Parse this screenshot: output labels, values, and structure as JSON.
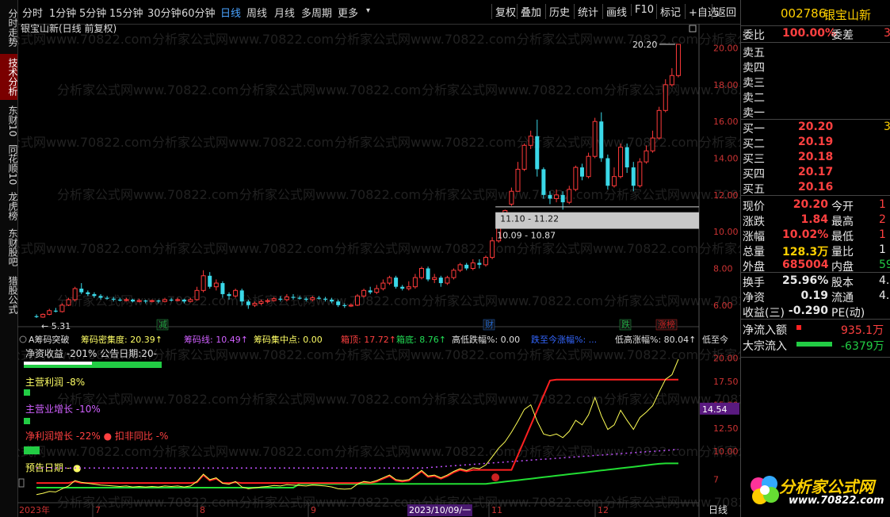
{
  "left_tabs": [
    {
      "label": "分时走势",
      "active": false
    },
    {
      "label": "技术分析",
      "active": true
    },
    {
      "label": "东财10",
      "active": false
    },
    {
      "label": "同花顺10",
      "active": false
    },
    {
      "label": "龙虎榜",
      "active": false
    },
    {
      "label": "东财股吧",
      "active": false
    },
    {
      "label": "猎股公式",
      "active": false
    }
  ],
  "toolbar": {
    "periods": [
      "分时",
      "1分钟",
      "5分钟",
      "15分钟",
      "30分钟",
      "60分钟",
      "日线",
      "周线",
      "月线",
      "多周期",
      "更多"
    ],
    "active_period": "日线",
    "more_arrow": "▾",
    "actions": [
      "复权",
      "叠加",
      "历史",
      "统计",
      "画线",
      "F10",
      "标记",
      "+自选",
      "返回"
    ]
  },
  "main_chart": {
    "title": "银宝山新(日线 前复权)",
    "y_ticks": [
      "20.00",
      "18.00",
      "16.00",
      "14.00",
      "12.00",
      "10.00",
      "8.00",
      "6.00"
    ],
    "max_label": "20.20",
    "min_label": "5.31",
    "range_high_label": "11.10 - 11.22",
    "range_low_label": "10.09 - 10.87"
  },
  "event_flags": [
    {
      "label": "减",
      "color": "#22aa44"
    },
    {
      "label": "财",
      "color": "#2266cc"
    },
    {
      "label": "跌",
      "color": "#22aa44"
    },
    {
      "label": "涨榜",
      "color": "#cc2222"
    }
  ],
  "indicator_header": [
    {
      "text": "A筹码突破",
      "color": "#e0e0e0"
    },
    {
      "text": "筹码密集度: 20.39↑",
      "color": "#ffff66"
    },
    {
      "text": "筹码线: 10.49↑",
      "color": "#d060ff"
    },
    {
      "text": "筹码集中点: 0.00",
      "color": "#ffff66"
    },
    {
      "text": "箱顶: 17.72↑",
      "color": "#ff4040"
    },
    {
      "text": "箱底: 8.76↑",
      "color": "#22dd55"
    },
    {
      "text": "高低跌幅%: 0.00",
      "color": "#e0e0e0"
    },
    {
      "text": "跌至今涨幅%: ...",
      "color": "#3366ff"
    },
    {
      "text": "低高涨幅%: 80.04↑",
      "color": "#e0e0e0"
    },
    {
      "text": "低至今",
      "color": "#e0e0e0"
    }
  ],
  "fundamentals": [
    {
      "text": "净资收益 -201%   公告日期:20-",
      "color": "#e0e0e0"
    },
    {
      "text": "主营利润 -8%",
      "color": "#ffff66"
    },
    {
      "text": "主营业增长 -10%",
      "color": "#d060ff"
    },
    {
      "text": "净利润增长 -22% ● 扣非同比 -%",
      "color": "#ff4040"
    },
    {
      "text": "预告日期 - ●",
      "color": "#ffff66"
    }
  ],
  "indicator_chart": {
    "y_ticks": [
      "20.00",
      "17.50",
      "15.00",
      "12.50",
      "10.00",
      "7"
    ],
    "current_value": "14.54",
    "x_labels": [
      "2023年",
      "7",
      "8",
      "9",
      "2023/10/09/一",
      "11",
      "12"
    ],
    "bottom_right": "日线"
  },
  "watermark": {
    "text": "分析家公式网www.70822.com"
  },
  "quote_panel": {
    "code": "002786",
    "name": "银宝山新",
    "wei_bi_label": "委比",
    "wei_bi": "100.00%",
    "wei_cha_label": "委差",
    "wei_cha": "3",
    "sell": [
      {
        "label": "卖五",
        "price": "",
        "vol": ""
      },
      {
        "label": "卖四",
        "price": "",
        "vol": ""
      },
      {
        "label": "卖三",
        "price": "",
        "vol": ""
      },
      {
        "label": "卖二",
        "price": "",
        "vol": ""
      },
      {
        "label": "卖一",
        "price": "",
        "vol": ""
      }
    ],
    "buy": [
      {
        "label": "买一",
        "price": "20.20",
        "vol": "3"
      },
      {
        "label": "买二",
        "price": "20.19",
        "vol": ""
      },
      {
        "label": "买三",
        "price": "20.18",
        "vol": ""
      },
      {
        "label": "买四",
        "price": "20.17",
        "vol": ""
      },
      {
        "label": "买五",
        "price": "20.16",
        "vol": ""
      }
    ],
    "stats": [
      {
        "l1": "现价",
        "v1": "20.20",
        "c1": "red",
        "l2": "今开",
        "v2": "1",
        "c2": "red"
      },
      {
        "l1": "涨跌",
        "v1": "1.84",
        "c1": "red",
        "l2": "最高",
        "v2": "2",
        "c2": "red"
      },
      {
        "l1": "涨幅",
        "v1": "10.02%",
        "c1": "red",
        "l2": "最低",
        "v2": "1",
        "c2": "red"
      },
      {
        "l1": "总量",
        "v1": "128.3万",
        "c1": "yellow",
        "l2": "量比",
        "v2": "1",
        "c2": "white"
      },
      {
        "l1": "外盘",
        "v1": "685004",
        "c1": "red",
        "l2": "内盘",
        "v2": "59",
        "c2": "green"
      }
    ],
    "stats2": [
      {
        "l1": "换手",
        "v1": "25.96%",
        "l2": "股本",
        "v2": "4."
      },
      {
        "l1": "净资",
        "v1": "0.19",
        "l2": "流通",
        "v2": "4."
      },
      {
        "l1": "收益(三)",
        "v1": "-0.290",
        "l2": "PE(动)",
        "v2": ""
      }
    ],
    "net_inflow_label": "净流入额",
    "net_inflow": "935.1万",
    "block_inflow_label": "大宗流入",
    "block_inflow": "-6379万"
  },
  "chart_data": {
    "type": "candlestick",
    "y_range": [
      5,
      21
    ],
    "candles": [
      [
        5.4,
        5.35,
        5.5,
        5.3
      ],
      [
        5.35,
        5.5,
        5.55,
        5.31
      ],
      [
        5.5,
        5.7,
        5.8,
        5.45
      ],
      [
        5.7,
        5.65,
        5.85,
        5.6
      ],
      [
        5.65,
        6.0,
        6.1,
        5.6
      ],
      [
        6.0,
        6.3,
        6.4,
        5.95
      ],
      [
        6.3,
        6.9,
        7.0,
        6.2
      ],
      [
        6.9,
        6.7,
        7.2,
        6.6
      ],
      [
        6.7,
        6.6,
        6.8,
        6.5
      ],
      [
        6.6,
        6.5,
        6.7,
        6.4
      ],
      [
        6.5,
        6.4,
        6.6,
        6.3
      ],
      [
        6.4,
        6.35,
        6.5,
        6.3
      ],
      [
        6.35,
        6.3,
        6.45,
        6.2
      ],
      [
        6.3,
        6.25,
        6.4,
        6.2
      ],
      [
        6.25,
        6.3,
        6.4,
        6.2
      ],
      [
        6.3,
        6.2,
        6.35,
        6.15
      ],
      [
        6.2,
        6.25,
        6.35,
        6.15
      ],
      [
        6.25,
        6.2,
        6.3,
        6.1
      ],
      [
        6.2,
        6.25,
        6.3,
        6.15
      ],
      [
        6.25,
        6.2,
        6.3,
        6.1
      ],
      [
        6.2,
        6.3,
        6.4,
        6.15
      ],
      [
        6.3,
        6.25,
        6.4,
        6.2
      ],
      [
        6.25,
        6.3,
        6.4,
        6.2
      ],
      [
        6.3,
        6.2,
        6.35,
        6.1
      ],
      [
        6.2,
        6.3,
        6.4,
        6.15
      ],
      [
        6.3,
        6.8,
        7.0,
        6.25
      ],
      [
        6.8,
        7.6,
        7.9,
        6.7
      ],
      [
        7.6,
        7.0,
        7.8,
        6.9
      ],
      [
        7.0,
        7.2,
        7.4,
        6.8
      ],
      [
        7.2,
        6.6,
        7.3,
        6.4
      ],
      [
        6.6,
        6.5,
        6.7,
        6.3
      ],
      [
        6.5,
        6.8,
        6.9,
        6.4
      ],
      [
        6.8,
        6.2,
        6.9,
        6.0
      ],
      [
        6.2,
        6.0,
        6.3,
        5.8
      ],
      [
        6.0,
        6.1,
        6.2,
        5.9
      ],
      [
        6.1,
        6.2,
        6.3,
        6.0
      ],
      [
        6.2,
        6.25,
        6.35,
        6.1
      ],
      [
        6.25,
        6.35,
        6.45,
        6.2
      ],
      [
        6.35,
        6.3,
        6.5,
        6.2
      ],
      [
        6.3,
        6.45,
        6.6,
        6.2
      ],
      [
        6.45,
        6.4,
        6.6,
        6.3
      ],
      [
        6.4,
        6.35,
        6.5,
        6.3
      ],
      [
        6.35,
        6.3,
        6.45,
        6.2
      ],
      [
        6.3,
        6.4,
        6.5,
        6.2
      ],
      [
        6.4,
        6.35,
        6.5,
        6.3
      ],
      [
        6.35,
        6.3,
        6.45,
        6.2
      ],
      [
        6.3,
        6.2,
        6.4,
        6.1
      ],
      [
        6.2,
        6.0,
        6.3,
        5.9
      ],
      [
        6.0,
        5.95,
        6.1,
        5.85
      ],
      [
        5.95,
        6.0,
        6.1,
        5.9
      ],
      [
        6.0,
        6.5,
        6.6,
        5.95
      ],
      [
        6.5,
        6.8,
        6.9,
        6.4
      ],
      [
        6.8,
        6.7,
        7.0,
        6.6
      ],
      [
        6.7,
        6.9,
        7.1,
        6.6
      ],
      [
        6.9,
        7.2,
        7.4,
        6.8
      ],
      [
        7.2,
        7.5,
        7.6,
        7.1
      ],
      [
        7.5,
        7.0,
        7.6,
        6.9
      ],
      [
        7.0,
        6.9,
        7.1,
        6.8
      ],
      [
        6.9,
        7.0,
        7.3,
        6.8
      ],
      [
        7.0,
        7.5,
        7.7,
        6.9
      ],
      [
        7.5,
        8.0,
        8.1,
        7.4
      ],
      [
        8.0,
        7.4,
        8.1,
        7.3
      ],
      [
        7.4,
        7.5,
        7.7,
        7.2
      ],
      [
        7.5,
        7.2,
        7.6,
        7.0
      ],
      [
        7.2,
        7.5,
        7.6,
        7.1
      ],
      [
        7.5,
        7.9,
        8.0,
        7.4
      ],
      [
        7.9,
        8.2,
        8.3,
        7.8
      ],
      [
        8.2,
        8.0,
        8.3,
        7.9
      ],
      [
        8.0,
        8.3,
        8.5,
        7.9
      ],
      [
        8.3,
        8.2,
        8.5,
        8.0
      ],
      [
        8.2,
        8.6,
        8.7,
        8.1
      ],
      [
        8.6,
        9.5,
        9.7,
        8.5
      ],
      [
        9.5,
        10.45,
        10.5,
        9.4
      ],
      [
        10.45,
        11.15,
        11.2,
        10.3
      ],
      [
        11.5,
        12.2,
        12.4,
        11.4
      ],
      [
        12.2,
        13.4,
        13.8,
        12.2
      ],
      [
        13.4,
        14.7,
        14.8,
        13.3
      ],
      [
        14.7,
        15.2,
        15.5,
        14.5
      ],
      [
        15.2,
        13.4,
        16.1,
        13.0
      ],
      [
        13.4,
        12.0,
        13.5,
        11.8
      ],
      [
        12.0,
        11.8,
        12.2,
        11.5
      ],
      [
        11.8,
        12.0,
        12.3,
        11.6
      ],
      [
        12.0,
        11.6,
        12.2,
        11.2
      ],
      [
        11.6,
        12.3,
        12.5,
        11.5
      ],
      [
        12.3,
        13.5,
        13.6,
        12.2
      ],
      [
        13.5,
        13.0,
        13.7,
        12.8
      ],
      [
        13.0,
        14.1,
        14.3,
        12.9
      ],
      [
        14.1,
        16.0,
        16.2,
        14.0
      ],
      [
        16.0,
        14.0,
        16.5,
        13.8
      ],
      [
        14.0,
        12.5,
        14.2,
        12.3
      ],
      [
        12.5,
        13.0,
        13.5,
        12.4
      ],
      [
        13.0,
        14.6,
        14.8,
        12.9
      ],
      [
        14.6,
        13.5,
        14.8,
        13.2
      ],
      [
        13.5,
        12.5,
        13.8,
        12.2
      ],
      [
        12.5,
        13.8,
        14.0,
        12.4
      ],
      [
        13.8,
        14.4,
        14.7,
        13.7
      ],
      [
        14.4,
        15.1,
        15.5,
        14.3
      ],
      [
        15.1,
        16.6,
        16.8,
        15.0
      ],
      [
        16.6,
        18.0,
        18.3,
        16.5
      ],
      [
        18.0,
        18.5,
        18.9,
        17.9
      ],
      [
        18.5,
        20.2,
        20.2,
        18.4
      ]
    ]
  }
}
